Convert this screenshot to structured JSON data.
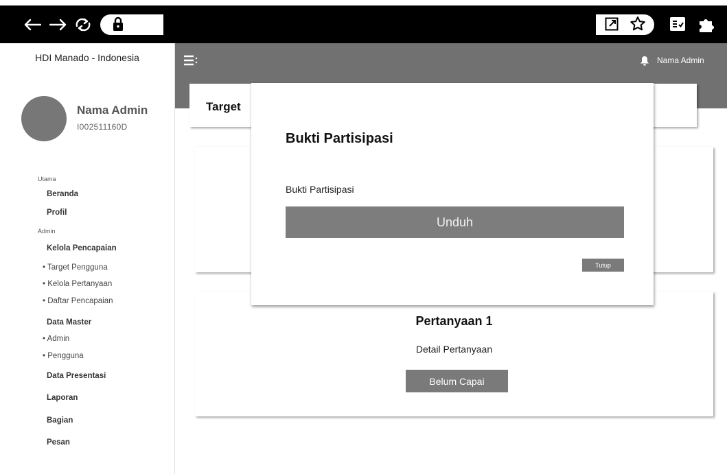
{
  "sidebar": {
    "brand": "HDI Manado - Indonesia",
    "profile": {
      "name": "Nama Admin",
      "id": "I002511160D"
    },
    "sections": {
      "utama": "Utama",
      "admin": "Admin"
    },
    "items": {
      "beranda": "Beranda",
      "profil": "Profil",
      "kelola_pencapaian": "Kelola Pencapaian",
      "target_pengguna": "Target Pengguna",
      "kelola_pertanyaan": "Kelola Pertanyaan",
      "daftar_pencapaian": "Daftar Pencapaian",
      "data_master": "Data Master",
      "admin": "Admin",
      "pengguna": "Pengguna",
      "data_presentasi": "Data Presentasi",
      "laporan": "Laporan",
      "bagian": "Bagian",
      "pesan": "Pesan"
    }
  },
  "header": {
    "user_name": "Nama Admin",
    "icons": [
      "menu-icon",
      "bell-icon"
    ]
  },
  "main": {
    "title": "Target",
    "question": {
      "title": "Pertanyaan 1",
      "detail": "Detail Pertanyaan",
      "status_button": "Belum Capai"
    }
  },
  "modal": {
    "title": "Bukti Partisipasi",
    "field_label": "Bukti Partisipasi",
    "download_button": "Unduh",
    "close_button": "Tutup"
  },
  "browser": {
    "icons": [
      "back-icon",
      "forward-icon",
      "reload-icon",
      "lock-icon",
      "open-external-icon",
      "star-icon",
      "reader-icon",
      "puzzle-icon"
    ]
  }
}
